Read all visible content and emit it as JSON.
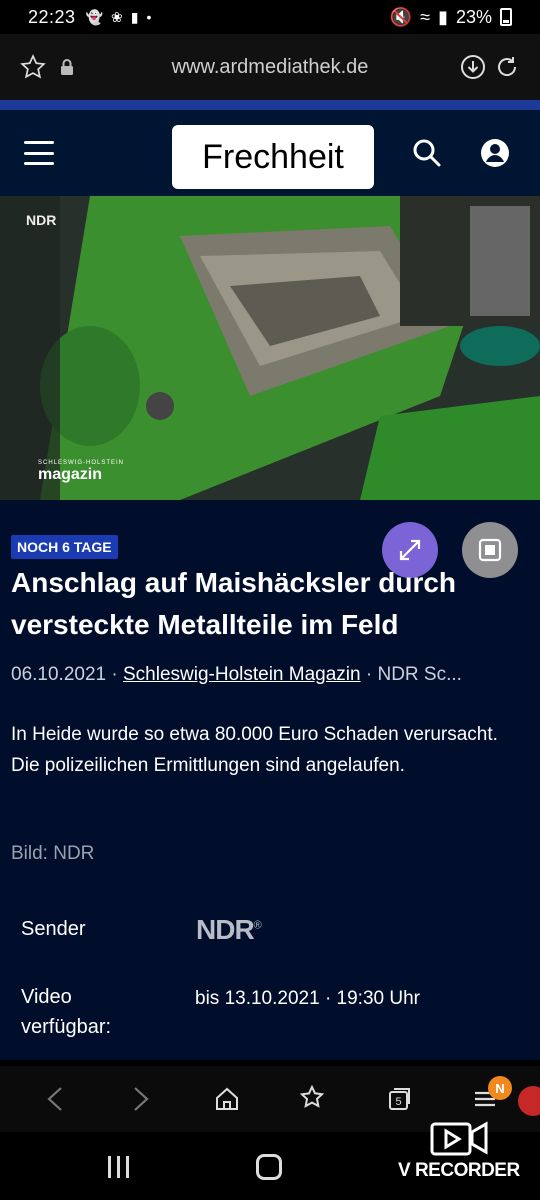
{
  "status_bar": {
    "time": "22:23",
    "battery": "23%"
  },
  "url_bar": {
    "url": "www.ardmediathek.de"
  },
  "header": {
    "title": "Frechheit"
  },
  "video": {
    "channel_tag": "NDR",
    "show_logo_small": "SCHLESWIG-HOLSTEIN",
    "show_logo": "magazin"
  },
  "article": {
    "badge": "NOCH 6 TAGE",
    "headline": "Anschlag auf Maishäcksler durch versteckte Metallteile im Feld",
    "date": "06.10.2021",
    "sep1": " · ",
    "show_link": "Schleswig-Holstein Magazin",
    "sep2": " · ",
    "channel_truncated": "NDR Sc...",
    "description": "In Heide wurde so etwa 80.000 Euro Schaden verursacht. Die polizeilichen Ermittlungen sind angelaufen.",
    "credit": "Bild: NDR",
    "sender_label": "Sender",
    "sender_logo": "NDR",
    "video_label_line1": "Video",
    "video_label_line2": "verfügbar:",
    "availability": "bis 13.10.2021 · 19:30 Uhr"
  },
  "browser_nav": {
    "tabs_count": "5",
    "notification_badge": "N"
  },
  "overlay": {
    "recorder_label": "V RECORDER"
  },
  "colors": {
    "header_bg": "#001532",
    "content_bg": "#000d2b",
    "badge_bg": "#1b3bb3",
    "expand_button": "#7a64d6",
    "accent_bar": "#1d3a99"
  }
}
